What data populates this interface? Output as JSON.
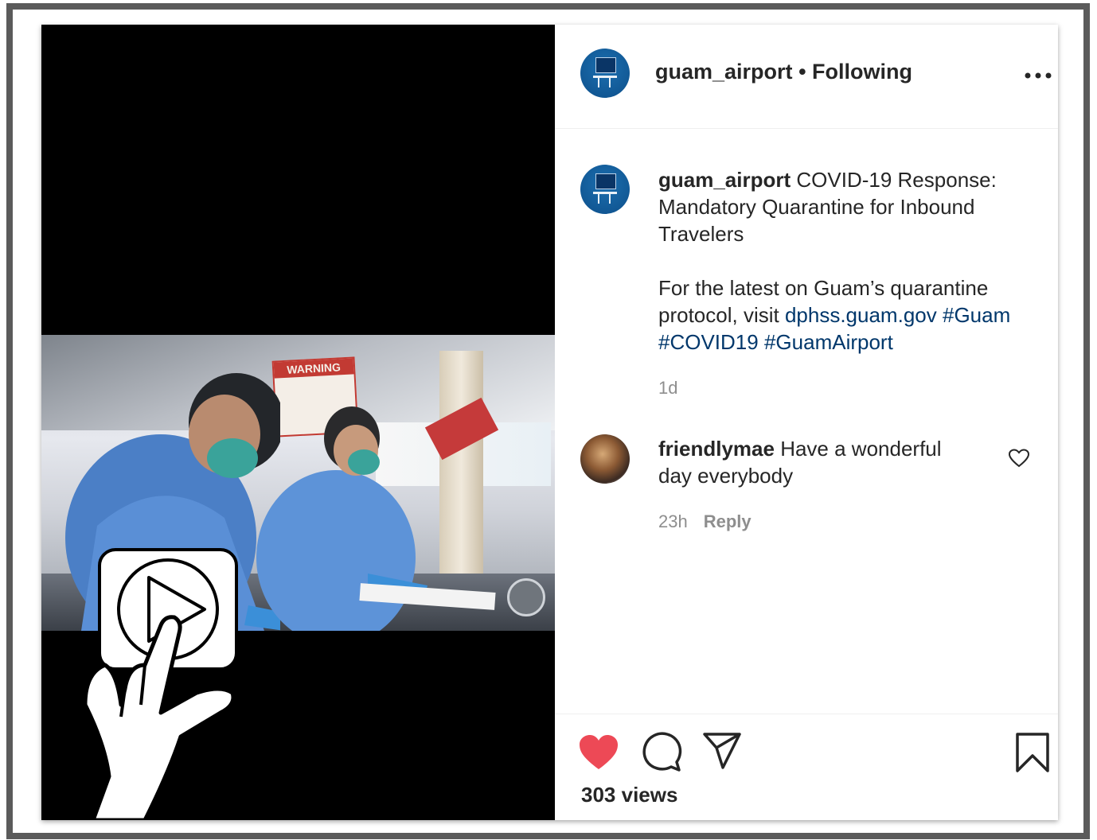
{
  "post": {
    "username": "guam_airport",
    "separator": "•",
    "follow_status": "Following",
    "caption": {
      "username": "guam_airport",
      "title": "COVID-19 Response: Mandatory Quarantine for Inbound Travelers",
      "body_prefix": "For the latest on Guam’s quarantine protocol, visit ",
      "link": "dphss.guam.gov",
      "hashtag1": "#Guam",
      "hashtag2": "#COVID19",
      "hashtag3": "#GuamAirport",
      "time": "1d"
    },
    "comment": {
      "username": "friendlymae",
      "text": "Have a wonderful day everybody",
      "time": "23h",
      "reply_label": "Reply"
    },
    "views": "303 views",
    "video_sign_text": "WARNING",
    "like_color": "#ed4956"
  }
}
